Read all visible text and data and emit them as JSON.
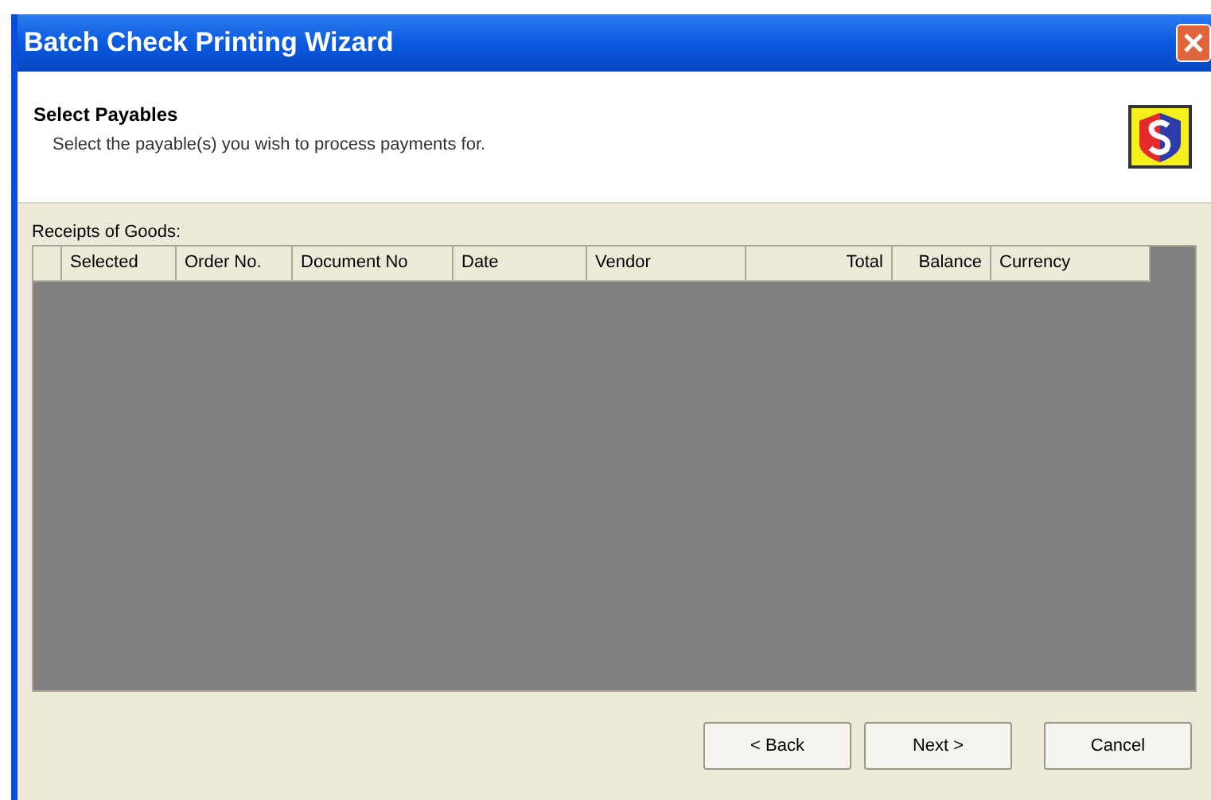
{
  "window": {
    "title": "Batch Check Printing Wizard"
  },
  "header": {
    "title": "Select Payables",
    "subtitle": "Select the payable(s) you wish to process payments for."
  },
  "table": {
    "label": "Receipts of Goods:",
    "columns": [
      {
        "label": "Selected",
        "kind": "text"
      },
      {
        "label": "Order No.",
        "kind": "text"
      },
      {
        "label": "Document No",
        "kind": "text"
      },
      {
        "label": "Date",
        "kind": "text"
      },
      {
        "label": "Vendor",
        "kind": "text"
      },
      {
        "label": "Total",
        "kind": "number"
      },
      {
        "label": "Balance",
        "kind": "number"
      },
      {
        "label": "Currency",
        "kind": "text"
      }
    ]
  },
  "buttons": [
    "< Back",
    "Next >",
    "Cancel"
  ]
}
